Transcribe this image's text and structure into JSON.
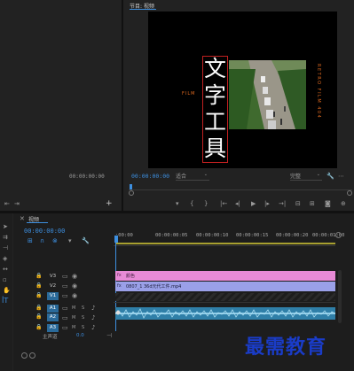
{
  "source_panel": {
    "timecode": "00:00:00:00"
  },
  "program_panel": {
    "title": "节目: 视频",
    "timecode": "00:00:00:00",
    "zoom": "适合",
    "quality": "完整",
    "overlay_big_text": [
      "文",
      "字",
      "工",
      "具"
    ],
    "overlay_film_left": "FILM",
    "overlay_retro_right": "RETRO FILM 404"
  },
  "timeline": {
    "title": "视频",
    "timecode": "00:00:00:00",
    "ruler": [
      ":00:00",
      "00:00:00:05",
      "00:00:00:10",
      "00:00:00:15",
      "00:00:00:20",
      "00:00:01:00"
    ],
    "video_tracks": [
      {
        "label": "V3",
        "target": false
      },
      {
        "label": "V2",
        "target": false
      },
      {
        "label": "V1",
        "target": true
      }
    ],
    "audio_tracks": [
      {
        "label": "A1",
        "target": true
      },
      {
        "label": "A2",
        "target": false
      },
      {
        "label": "A3",
        "target": false
      }
    ],
    "master_label": "主声道",
    "master_value": "0.0",
    "clips": {
      "v2_clip": "颜色",
      "v1_clip": "0807_1 36d元代工件.mp4"
    }
  },
  "watermark": "最需教育"
}
